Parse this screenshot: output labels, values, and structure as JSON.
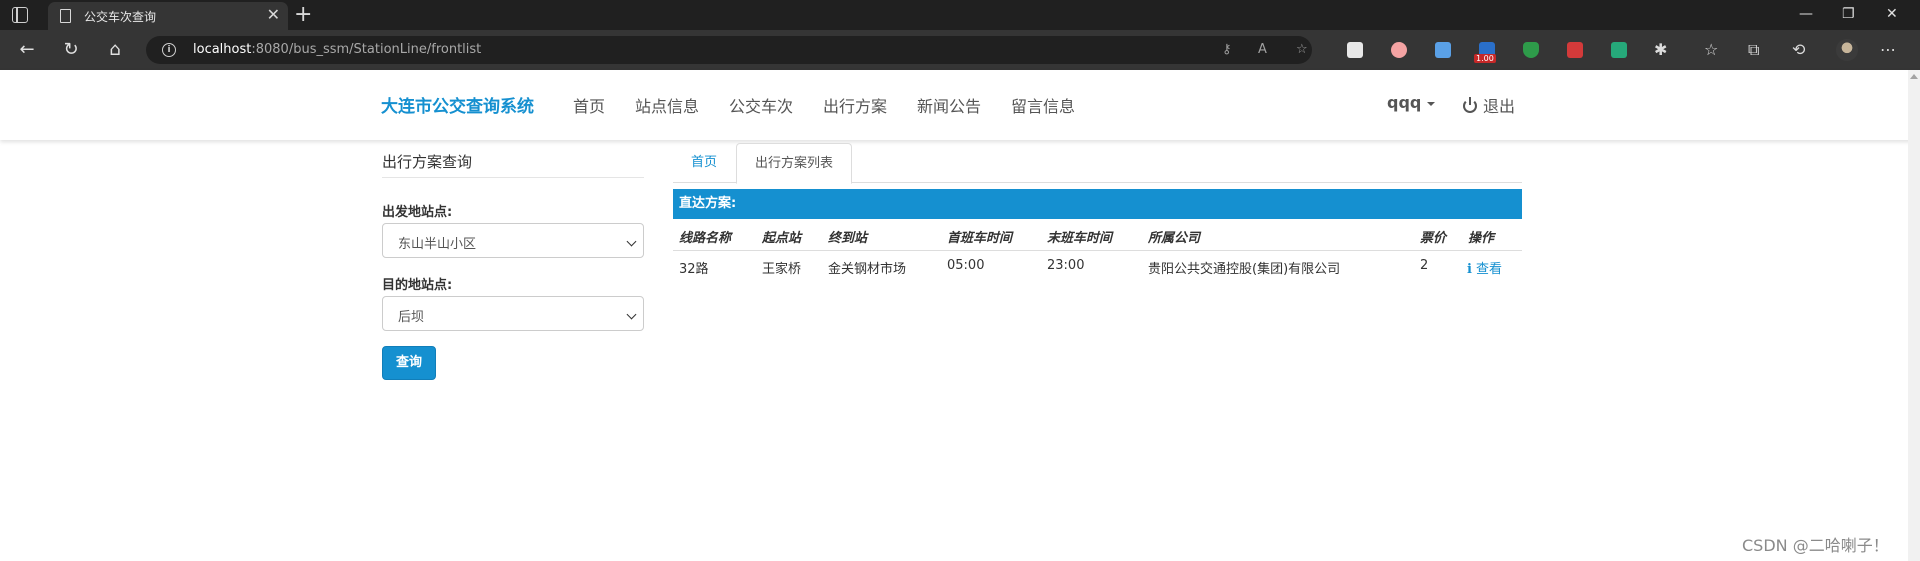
{
  "browser": {
    "tab_title": "公交车次查询",
    "tab_close": "✕",
    "new_tab": "+",
    "url_host": "localhost",
    "url_rest": ":8080/bus_ssm/StationLine/frontlist",
    "extension_badge": "1.00"
  },
  "navbar": {
    "brand": "大连市公交查询系统",
    "items": [
      "首页",
      "站点信息",
      "公交车次",
      "出行方案",
      "新闻公告",
      "留言信息"
    ],
    "user": "qqq",
    "logout": "退出"
  },
  "form": {
    "title": "出行方案查询",
    "origin_label": "出发地站点:",
    "origin_value": "东山半山小区",
    "dest_label": "目的地站点:",
    "dest_value": "后坝",
    "submit": "查询"
  },
  "tabs": [
    "首页",
    "出行方案列表"
  ],
  "results": {
    "section_title": "直达方案:",
    "headers": [
      "线路名称",
      "起点站",
      "终到站",
      "首班车时间",
      "末班车时间",
      "所属公司",
      "票价",
      "操作"
    ],
    "rows": [
      {
        "line": "32路",
        "start": "王家桥",
        "end": "金关钢材市场",
        "first": "05:00",
        "last": "23:00",
        "company": "贵阳公共交通控股(集团)有限公司",
        "price": "2",
        "action": "查看"
      }
    ]
  },
  "watermark": "CSDN @二哈喇子！",
  "colors": {
    "accent": "#1590d0",
    "chrome_dark": "#202020",
    "chrome_mid": "#353535"
  }
}
